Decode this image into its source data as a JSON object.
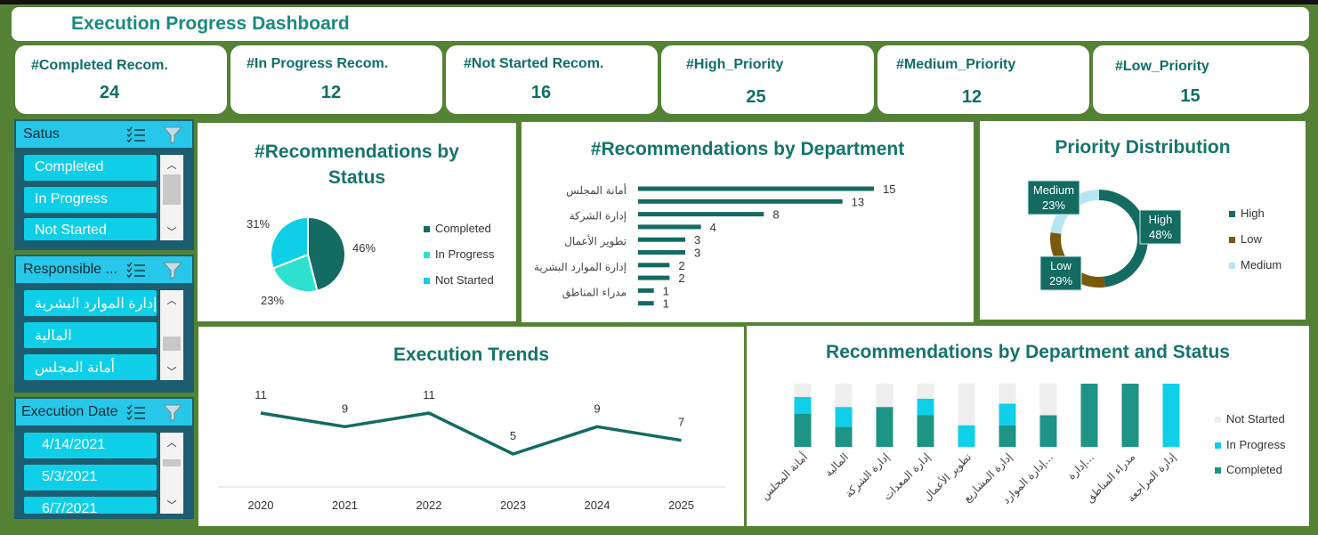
{
  "dashboard": {
    "title": "Execution Progress Dashboard"
  },
  "kpis": [
    {
      "label": "#Completed Recom.",
      "value": "24"
    },
    {
      "label": "#In Progress Recom.",
      "value": "12"
    },
    {
      "label": "#Not Started Recom.",
      "value": "16"
    },
    {
      "label": "#High_Priority",
      "value": "25"
    },
    {
      "label": "#Medium_Priority",
      "value": "12"
    },
    {
      "label": "#Low_Priority",
      "value": "15"
    }
  ],
  "slicers": {
    "status": {
      "title": "Satus",
      "items": [
        "Completed",
        "In Progress",
        "Not Started"
      ]
    },
    "responsible": {
      "title": "Responsible ...",
      "items": [
        "إدارة الموارد البشرية",
        "المالية",
        "أمانة المجلس"
      ]
    },
    "date": {
      "title": "Execution Date",
      "items": [
        "4/14/2021",
        "5/3/2021",
        "6/7/2021"
      ]
    }
  },
  "colors": {
    "background": "#548235",
    "completed": "#136b62",
    "in_progress": "#2ee0d0",
    "not_started": "#0fcfe8",
    "high": "#136b62",
    "low": "#7a5a0a",
    "medium": "#b7e6f2",
    "dept_completed": "#1e9486",
    "dept_in_progress": "#10cfe8",
    "dept_not_started": "#eeeeee",
    "accent_text": "#15746b"
  },
  "icons": [
    "multi-select-icon",
    "clear-filter-icon",
    "scroll-up-icon",
    "scroll-down-icon"
  ],
  "chart_data": [
    {
      "id": "status",
      "type": "pie",
      "title": "#Recommendations by Status",
      "labels": [
        "Completed",
        "In Progress",
        "Not Started"
      ],
      "values": [
        46,
        23,
        31
      ],
      "data_labels": [
        "46%",
        "23%",
        "31%"
      ],
      "legend": "right"
    },
    {
      "id": "department",
      "type": "bar",
      "orientation": "horizontal",
      "title": "#Recommendations by Department",
      "categories": [
        "أمانة المجلس",
        "",
        "إدارة الشركة",
        "",
        "تطوير الأعمال",
        "",
        "إدارة الموارد البشرية",
        "",
        "مدراء المناطق",
        ""
      ],
      "values": [
        15,
        13,
        8,
        4,
        3,
        3,
        2,
        2,
        1,
        1
      ],
      "xlim": [
        0,
        15
      ]
    },
    {
      "id": "priority",
      "type": "pie",
      "subtype": "donut",
      "title": "Priority Distribution",
      "labels": [
        "High",
        "Low",
        "Medium"
      ],
      "values": [
        48,
        29,
        23
      ],
      "data_labels": [
        "48%",
        "29%",
        "23%"
      ],
      "legend": "right"
    },
    {
      "id": "trends",
      "type": "line",
      "title": "Execution Trends",
      "x": [
        "2020",
        "2021",
        "2022",
        "2023",
        "2024",
        "2025"
      ],
      "values": [
        11,
        9,
        11,
        5,
        9,
        7
      ],
      "ylim": [
        0,
        12
      ]
    },
    {
      "id": "dept_status",
      "type": "bar",
      "stacked": true,
      "title": "Recommendations by Department and Status",
      "categories": [
        "أمانة المجلس",
        "المالية",
        "إدارة الشركة",
        "إدارة المعدات",
        "تطوير الأعمال",
        "إدارة المشاريع",
        "إدارة الموارد…",
        "إدارة…",
        "مدراء المناطق",
        "إدارة المراجعة"
      ],
      "series": [
        {
          "name": "Completed",
          "values": [
            2,
            1.2,
            2.4,
            1.9,
            0,
            1.3,
            1.9,
            3.8,
            3.8,
            0
          ]
        },
        {
          "name": "In Progress",
          "values": [
            1,
            1.2,
            0,
            1,
            1.3,
            1.3,
            0,
            0,
            0,
            3.8
          ]
        },
        {
          "name": "Not Started",
          "values": [
            0.8,
            1.4,
            1.4,
            0.9,
            2.5,
            1.2,
            1.9,
            0,
            0,
            0
          ]
        }
      ],
      "ylim": [
        0,
        3.8
      ],
      "legend": "right"
    }
  ]
}
